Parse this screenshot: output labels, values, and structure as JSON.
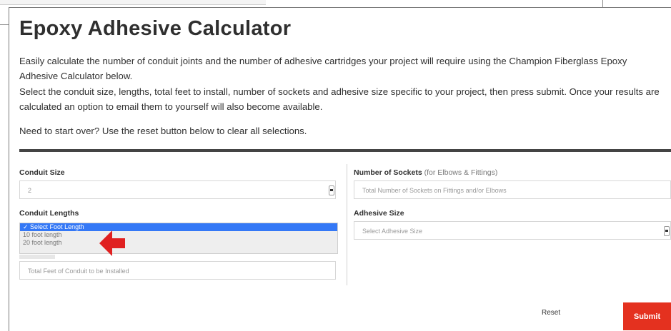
{
  "header": {
    "title": "Epoxy Adhesive Calculator"
  },
  "intro": {
    "p1": "Easily calculate the number of conduit joints and the number of adhesive cartridges your project will require using the Champion Fiberglass Epoxy Adhesive Calculator below.",
    "p2": "Select the conduit size, lengths, total feet to install, number of sockets and adhesive size specific to your project, then press submit. Once your results are calculated an option to email them to yourself will also become available.",
    "p3": "Need to start over? Use the reset button below to clear all selections."
  },
  "form": {
    "conduit_size": {
      "label": "Conduit Size",
      "value": "2"
    },
    "conduit_lengths": {
      "label": "Conduit Lengths",
      "options": [
        "✓ Select Foot Length",
        "10 foot length",
        "20 foot length"
      ]
    },
    "total_feet": {
      "placeholder": "Total Feet of Conduit to be Installed"
    },
    "sockets": {
      "label": "Number of Sockets",
      "label_sub": " (for Elbows & Fittings)",
      "placeholder": "Total Number of Sockets on Fittings and/or Elbows"
    },
    "adhesive_size": {
      "label": "Adhesive Size",
      "value": "Select Adhesive Size"
    }
  },
  "actions": {
    "reset_label": "Reset",
    "submit_label": "Submit"
  },
  "colors": {
    "submit": "#e4311f",
    "highlight_option": "#3478f6",
    "arrow": "#e02020"
  },
  "icons": {
    "annotation": "red-arrow-icon"
  }
}
